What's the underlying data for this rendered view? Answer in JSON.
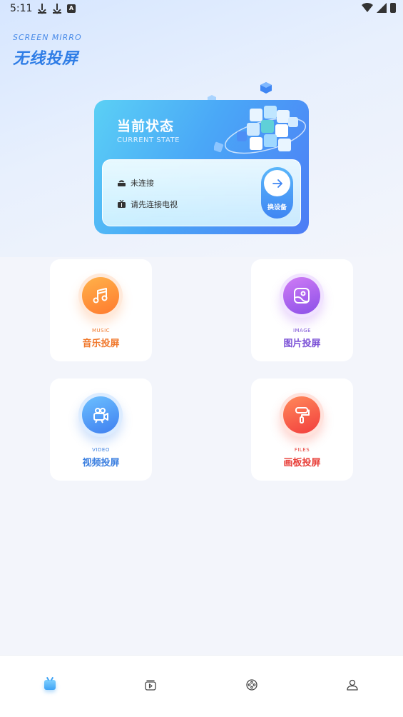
{
  "status_bar": {
    "time": "5:11",
    "left_icons": [
      "download-icon",
      "download-icon",
      "accessibility-icon"
    ],
    "right_icons": [
      "wifi-icon",
      "signal-icon",
      "battery-icon"
    ]
  },
  "header": {
    "brand_en": "SCREEN MIRRO",
    "brand_cn": "无线投屏"
  },
  "state_card": {
    "title": "当前状态",
    "subtitle": "CURRENT STATE",
    "connection_status": "未连接",
    "hint": "请先连接电视",
    "switch_label": "换设备"
  },
  "features": [
    {
      "en": "MUSIC",
      "cn": "音乐投屏",
      "icon": "music-note-icon",
      "color": "#f0782c"
    },
    {
      "en": "IMAGE",
      "cn": "图片投屏",
      "icon": "image-icon",
      "color": "#7a4fd6"
    },
    {
      "en": "VIDEO",
      "cn": "视频投屏",
      "icon": "video-camera-icon",
      "color": "#3b7fe0"
    },
    {
      "en": "FILES",
      "cn": "画板投屏",
      "icon": "paint-roller-icon",
      "color": "#e8403a"
    }
  ],
  "bottom_nav": {
    "items": [
      "tv-icon",
      "media-icon",
      "discover-icon",
      "profile-icon"
    ],
    "active": "tv-icon",
    "accent": "#3fa3f5"
  }
}
